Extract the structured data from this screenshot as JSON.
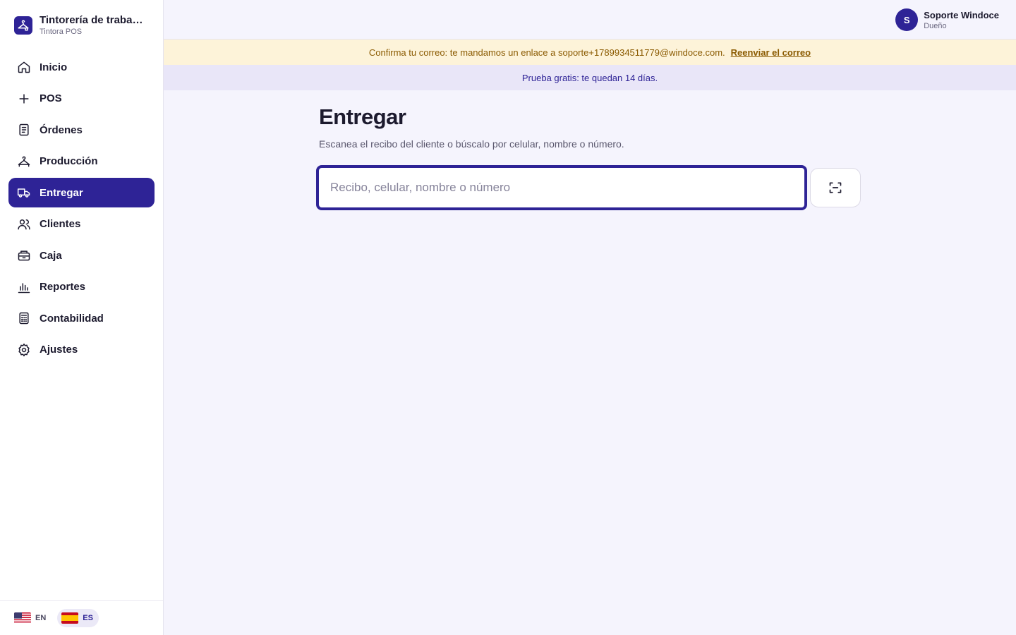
{
  "brand": {
    "name": "Tintorería de trabaj…",
    "subtitle": "Tintora POS"
  },
  "nav": [
    {
      "label": "Inicio",
      "icon": "home-icon"
    },
    {
      "label": "POS",
      "icon": "plus-icon"
    },
    {
      "label": "Órdenes",
      "icon": "receipt-icon"
    },
    {
      "label": "Producción",
      "icon": "hanger-icon"
    },
    {
      "label": "Entregar",
      "icon": "truck-icon",
      "active": true
    },
    {
      "label": "Clientes",
      "icon": "users-icon"
    },
    {
      "label": "Caja",
      "icon": "register-icon"
    },
    {
      "label": "Reportes",
      "icon": "bar-chart-icon"
    },
    {
      "label": "Contabilidad",
      "icon": "calculator-icon"
    },
    {
      "label": "Ajustes",
      "icon": "gear-icon"
    }
  ],
  "languages": [
    {
      "code": "EN",
      "flag": "us-flag-icon",
      "active": false
    },
    {
      "code": "ES",
      "flag": "es-flag-icon",
      "active": true
    }
  ],
  "user": {
    "initial": "S",
    "name": "Soporte Windoce",
    "role": "Dueño"
  },
  "banners": {
    "email_confirm": "Confirma tu correo: te mandamos un enlace a soporte+1789934511779@windoce.com.",
    "resend_link": "Reenviar el correo",
    "trial": "Prueba gratis: te quedan 14 días."
  },
  "page": {
    "title": "Entregar",
    "subtitle": "Escanea el recibo del cliente o búscalo por celular, nombre o número.",
    "search_placeholder": "Recibo, celular, nombre o número",
    "search_value": "",
    "scan_icon": "scan-icon"
  },
  "colors": {
    "accent": "#2e2396",
    "warn_bg": "#fdf3d9",
    "warn_text": "#8a5a00",
    "trial_bg": "#e9e6f8",
    "page_bg": "#f5f4fd"
  }
}
